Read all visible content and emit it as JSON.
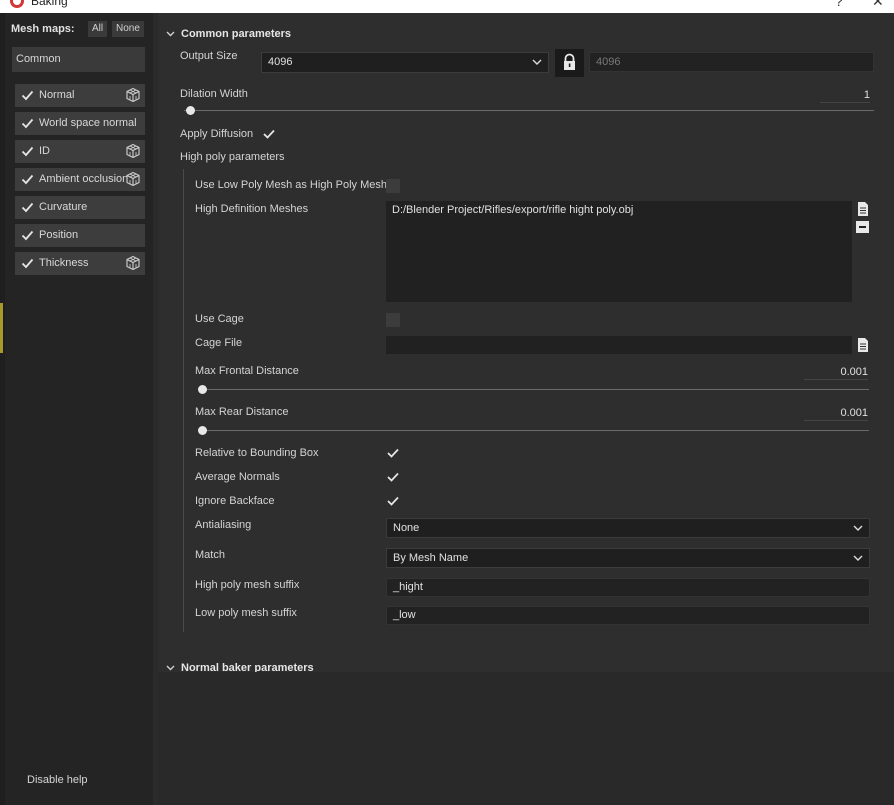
{
  "window": {
    "title": "Baking"
  },
  "sidebar": {
    "mesh_maps_label": "Mesh maps:",
    "all_label": "All",
    "none_label": "None",
    "common_label": "Common",
    "maps": [
      {
        "label": "Normal",
        "checked": true,
        "has_cube": true
      },
      {
        "label": "World space normal",
        "checked": true,
        "has_cube": false
      },
      {
        "label": "ID",
        "checked": true,
        "has_cube": true
      },
      {
        "label": "Ambient occlusion",
        "checked": true,
        "has_cube": true
      },
      {
        "label": "Curvature",
        "checked": true,
        "has_cube": false
      },
      {
        "label": "Position",
        "checked": true,
        "has_cube": false
      },
      {
        "label": "Thickness",
        "checked": true,
        "has_cube": true
      }
    ],
    "disable_help": "Disable help"
  },
  "common": {
    "section_title": "Common parameters",
    "output_size_label": "Output Size",
    "output_size_value": "4096",
    "output_size_locked_value": "4096",
    "dilation_label": "Dilation Width",
    "dilation_value": "1",
    "apply_diffusion_label": "Apply Diffusion",
    "apply_diffusion": true,
    "high_poly_title": "High poly parameters"
  },
  "high_poly": {
    "use_low_label": "Use Low Poly Mesh as High Poly Mesh",
    "use_low": false,
    "hd_meshes_label": "High Definition Meshes",
    "hd_meshes_value": "D:/Blender Project/Rifles/export/rifle hight poly.obj",
    "use_cage_label": "Use Cage",
    "use_cage": false,
    "cage_file_label": "Cage File",
    "cage_file_value": "",
    "max_frontal_label": "Max Frontal Distance",
    "max_frontal_value": "0.001",
    "max_rear_label": "Max Rear Distance",
    "max_rear_value": "0.001",
    "relative_bbox_label": "Relative to Bounding Box",
    "relative_bbox": true,
    "average_normals_label": "Average Normals",
    "average_normals": true,
    "ignore_backface_label": "Ignore Backface",
    "ignore_backface": true,
    "antialiasing_label": "Antialiasing",
    "antialiasing_value": "None",
    "match_label": "Match",
    "match_value": "By Mesh Name",
    "high_suffix_label": "High poly mesh suffix",
    "high_suffix_value": "_hight",
    "low_suffix_label": "Low poly mesh suffix",
    "low_suffix_value": "_low"
  },
  "normal_section": {
    "title": "Normal baker parameters"
  },
  "colors": {
    "accent": "#d23838",
    "panel": "#2e2e2e",
    "sidebar": "#242424"
  }
}
